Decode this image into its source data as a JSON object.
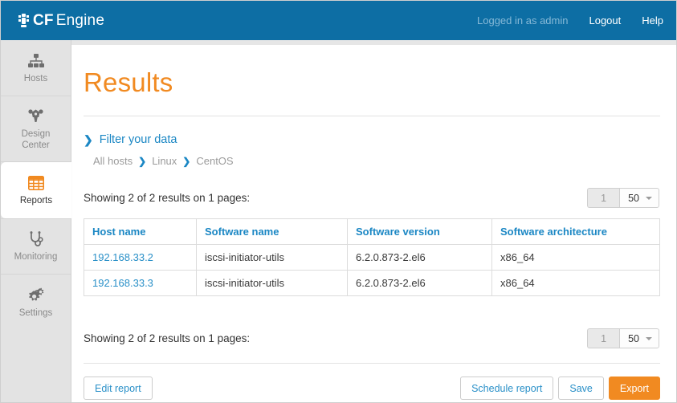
{
  "topbar": {
    "brand_cf": "CF",
    "brand_engine": "Engine",
    "logo_icon": "cfengine-logo-icon",
    "logged_in_text": "Logged in as admin",
    "logout_label": "Logout",
    "help_label": "Help",
    "background_color": "#0d6ea4"
  },
  "sidebar": {
    "items": [
      {
        "label": "Hosts",
        "icon": "hierarchy-icon",
        "active": false
      },
      {
        "label": "Design\nCenter",
        "label_line1": "Design",
        "label_line2": "Center",
        "icon": "design-center-icon",
        "active": false
      },
      {
        "label": "Reports",
        "icon": "grid-table-icon",
        "active": true
      },
      {
        "label": "Monitoring",
        "icon": "stethoscope-icon",
        "active": false
      },
      {
        "label": "Settings",
        "icon": "gears-icon",
        "active": false
      }
    ],
    "active_color": "#f18a21"
  },
  "main": {
    "page_title": "Results",
    "title_color": "#f18a21",
    "filter": {
      "chevron_icon": "chevron-right-icon",
      "label": "Filter your data"
    },
    "breadcrumb": {
      "items": [
        "All hosts",
        "Linux",
        "CentOS"
      ],
      "separator": "❯",
      "separator_icon": "chevron-right-icon"
    },
    "showing_text": "Showing 2 of 2 results on 1 pages:",
    "pagination": {
      "page_number": "1",
      "page_size": "50",
      "caret_icon": "chevron-down-icon"
    },
    "table": {
      "columns": [
        "Host name",
        "Software name",
        "Software version",
        "Software architecture"
      ],
      "rows": [
        {
          "host_name": "192.168.33.2",
          "software_name": "iscsi-initiator-utils",
          "software_version": "6.2.0.873-2.el6",
          "software_architecture": "x86_64"
        },
        {
          "host_name": "192.168.33.3",
          "software_name": "iscsi-initiator-utils",
          "software_version": "6.2.0.873-2.el6",
          "software_architecture": "x86_64"
        }
      ],
      "header_color": "#1b87c4",
      "link_color": "#2a90c8"
    },
    "buttons": {
      "edit_report": "Edit report",
      "schedule_report": "Schedule report",
      "save": "Save",
      "export": "Export",
      "export_color": "#f18a21"
    }
  }
}
